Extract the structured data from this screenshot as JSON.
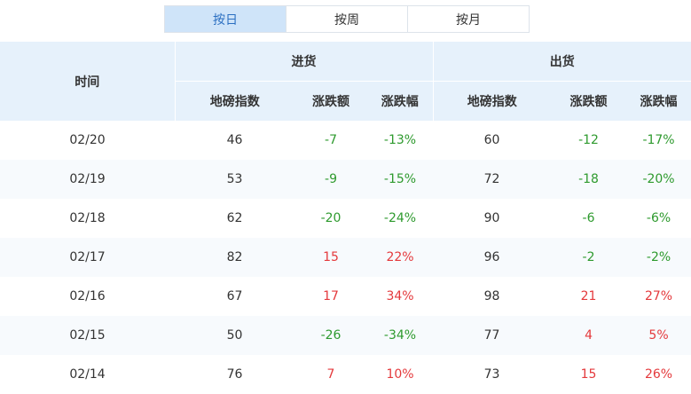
{
  "tabs": [
    {
      "label": "按日",
      "active": true
    },
    {
      "label": "按周",
      "active": false
    },
    {
      "label": "按月",
      "active": false
    }
  ],
  "header": {
    "date": "时间",
    "inbound": "进货",
    "outbound": "出货",
    "sub": [
      "地磅指数",
      "涨跌额",
      "涨跌幅",
      "地磅指数",
      "涨跌额",
      "涨跌幅"
    ]
  },
  "colors": {
    "up": "#e4393c",
    "down": "#2e9a2e",
    "active_tab_bg": "#cfe4f9",
    "header_bg": "#e6f1fb"
  },
  "rows": [
    {
      "date": "02/20",
      "in_idx": "46",
      "in_chg": "-7",
      "in_pct": "-13%",
      "out_idx": "60",
      "out_chg": "-12",
      "out_pct": "-17%"
    },
    {
      "date": "02/19",
      "in_idx": "53",
      "in_chg": "-9",
      "in_pct": "-15%",
      "out_idx": "72",
      "out_chg": "-18",
      "out_pct": "-20%"
    },
    {
      "date": "02/18",
      "in_idx": "62",
      "in_chg": "-20",
      "in_pct": "-24%",
      "out_idx": "90",
      "out_chg": "-6",
      "out_pct": "-6%"
    },
    {
      "date": "02/17",
      "in_idx": "82",
      "in_chg": "15",
      "in_pct": "22%",
      "out_idx": "96",
      "out_chg": "-2",
      "out_pct": "-2%"
    },
    {
      "date": "02/16",
      "in_idx": "67",
      "in_chg": "17",
      "in_pct": "34%",
      "out_idx": "98",
      "out_chg": "21",
      "out_pct": "27%"
    },
    {
      "date": "02/15",
      "in_idx": "50",
      "in_chg": "-26",
      "in_pct": "-34%",
      "out_idx": "77",
      "out_chg": "4",
      "out_pct": "5%"
    },
    {
      "date": "02/14",
      "in_idx": "76",
      "in_chg": "7",
      "in_pct": "10%",
      "out_idx": "73",
      "out_chg": "15",
      "out_pct": "26%"
    }
  ]
}
